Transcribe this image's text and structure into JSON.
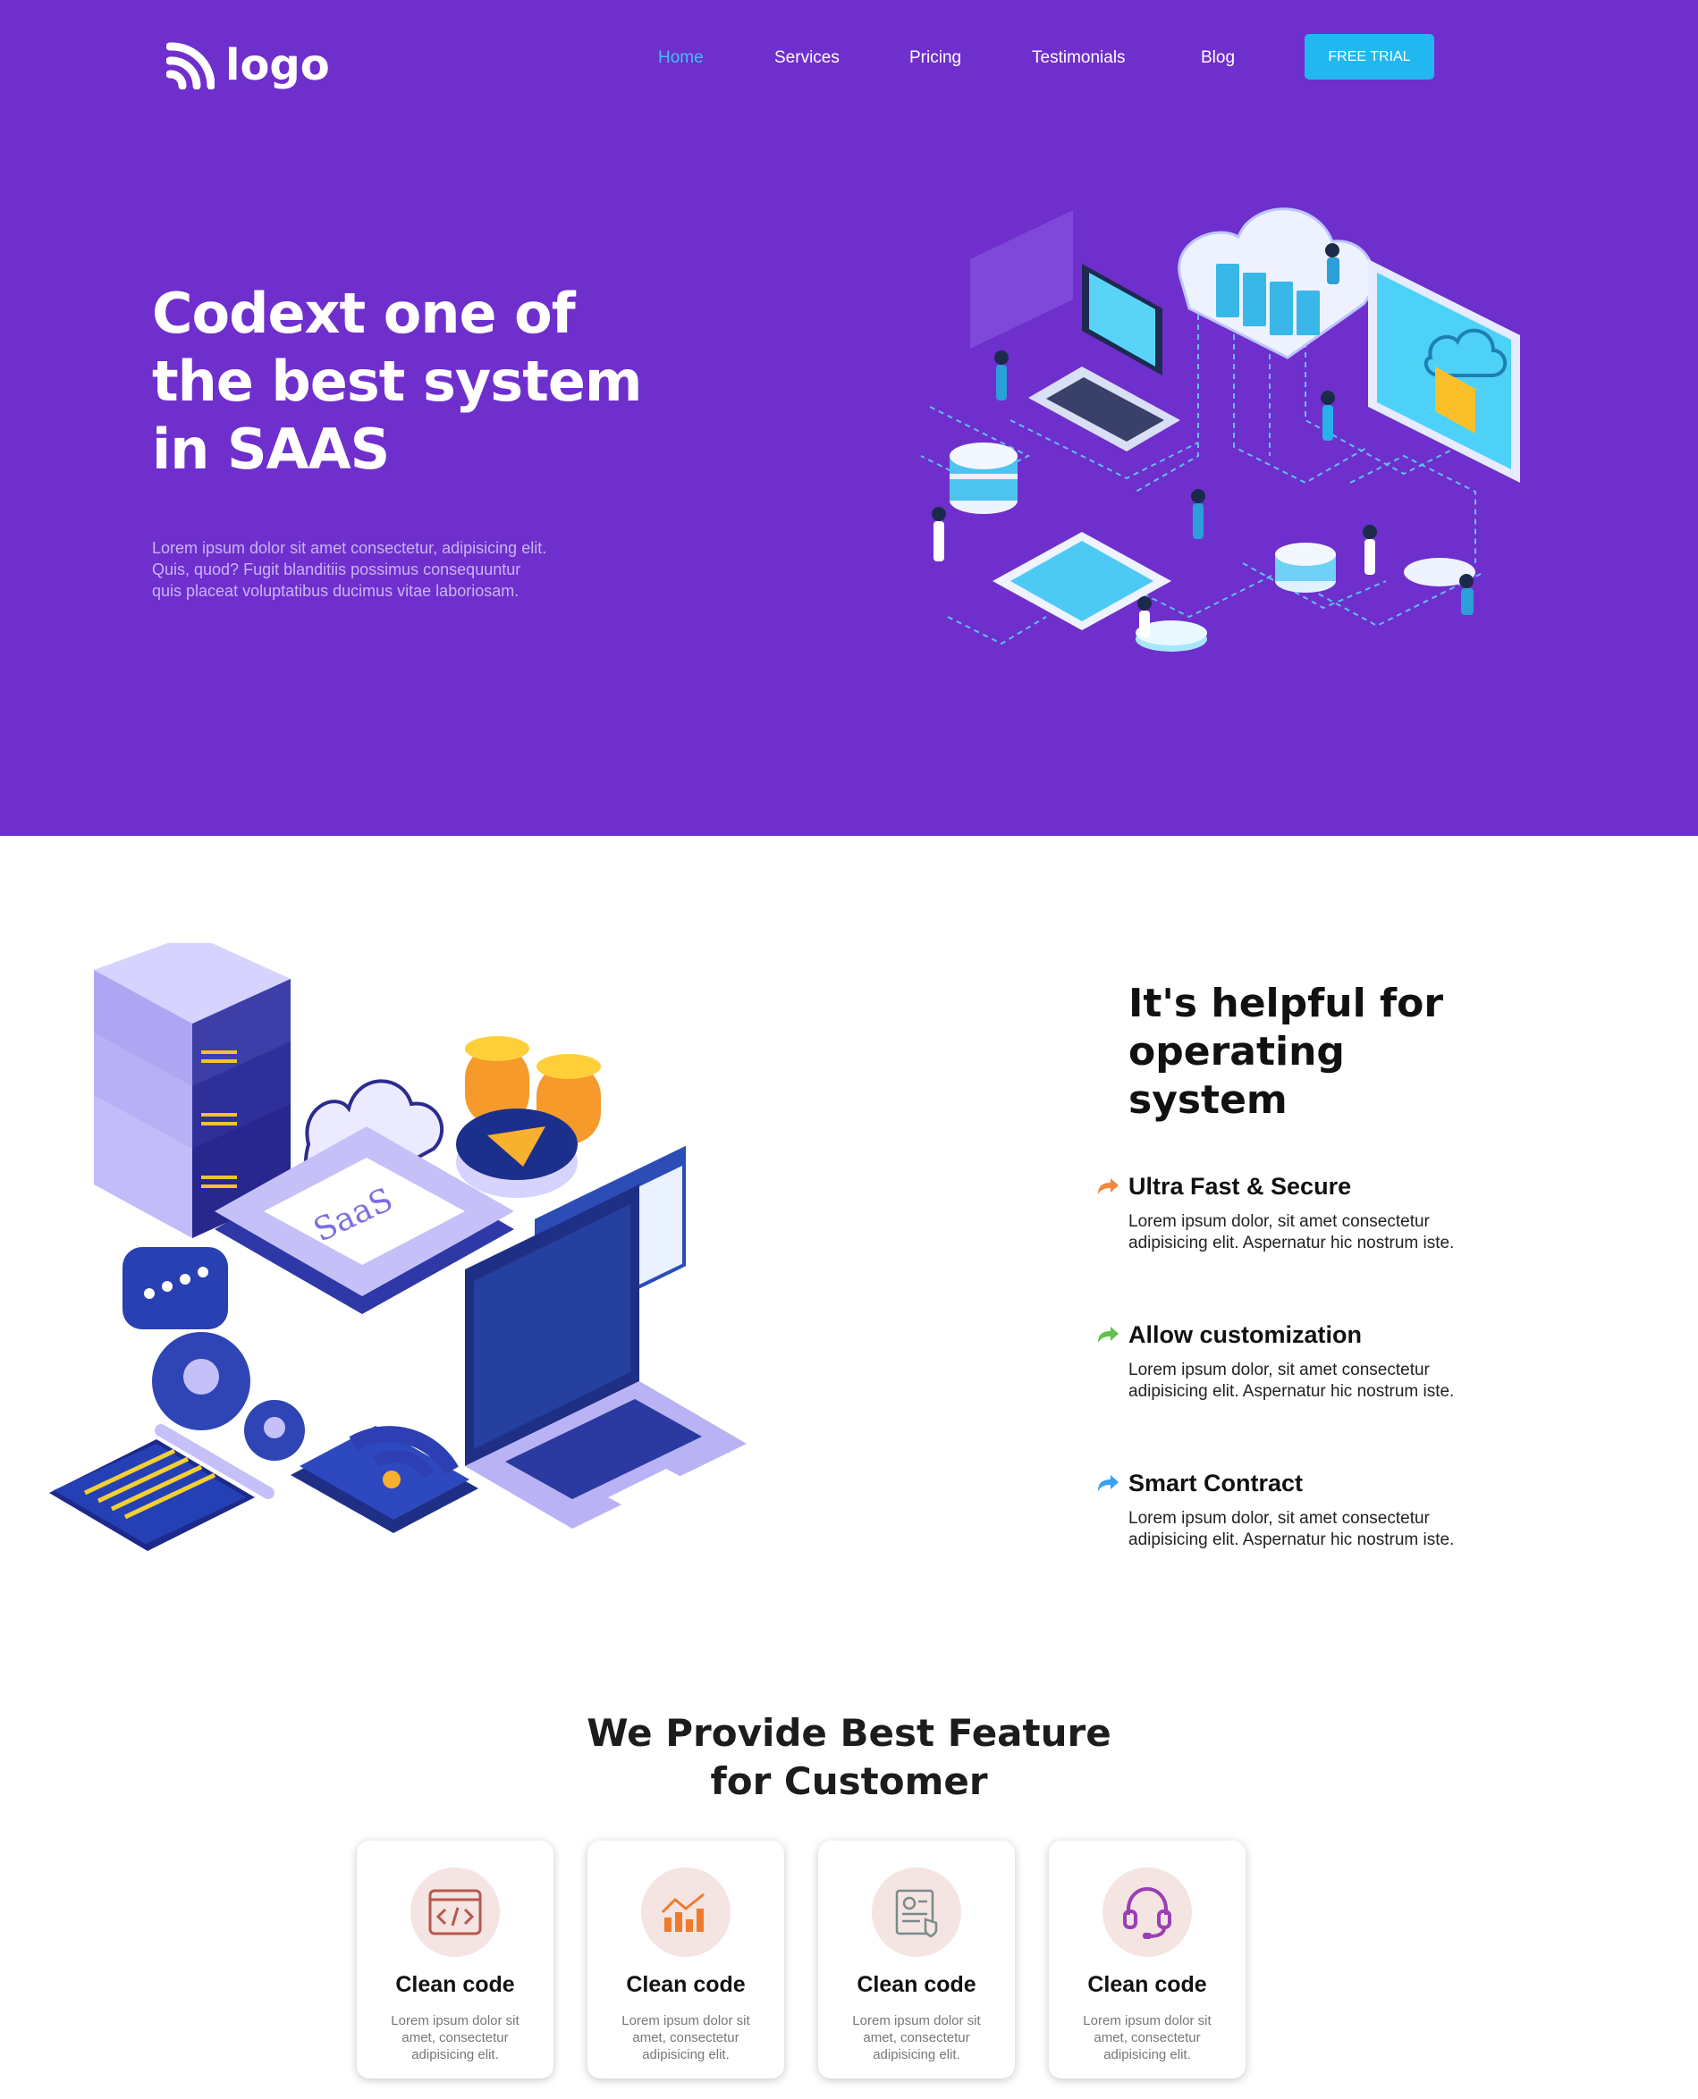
{
  "header": {
    "logo_text": "logo",
    "nav": [
      "Home",
      "Services",
      "Pricing",
      "Testimonials",
      "Blog"
    ],
    "cta_label": "FREE TRIAL"
  },
  "hero": {
    "title_lines": [
      "Codext one of",
      "the best system",
      "in SAAS"
    ],
    "text_lines": [
      "Lorem ipsum dolor sit amet consectetur, adipisicing elit.",
      "Quis, quod? Fugit blanditiis possimus consequuntur",
      "quis placeat voluptatibus ducimus vitae laboriosam."
    ]
  },
  "about": {
    "title_lines": [
      "It's helpful for operating",
      "system"
    ],
    "illustration_text": "SaaS",
    "features": [
      {
        "title": "Ultra Fast & Secure",
        "text": [
          "Lorem ipsum dolor, sit amet consectetur",
          "adipisicing elit. Aspernatur hic nostrum iste."
        ],
        "arrow_color": "#f0883e"
      },
      {
        "title": "Allow customization",
        "text": [
          "Lorem ipsum dolor, sit amet consectetur",
          "adipisicing elit. Aspernatur hic nostrum iste."
        ],
        "arrow_color": "#5cc54a"
      },
      {
        "title": "Smart Contract",
        "text": [
          "Lorem ipsum dolor, sit amet consectetur",
          "adipisicing elit. Aspernatur hic nostrum iste."
        ],
        "arrow_color": "#3aa0f0"
      }
    ]
  },
  "services": {
    "title_lines": [
      "We Provide Best Feature",
      "for Customer"
    ],
    "cards": [
      {
        "icon": "code-icon",
        "title": "Clean code",
        "text": [
          "Lorem ipsum dolor sit",
          "amet, consectetur",
          "adipisicing elit."
        ]
      },
      {
        "icon": "chart-icon",
        "title": "Clean code",
        "text": [
          "Lorem ipsum dolor sit",
          "amet, consectetur",
          "adipisicing elit."
        ]
      },
      {
        "icon": "certificate-icon",
        "title": "Clean code",
        "text": [
          "Lorem ipsum dolor sit",
          "amet, consectetur",
          "adipisicing elit."
        ]
      },
      {
        "icon": "headset-icon",
        "title": "Clean code",
        "text": [
          "Lorem ipsum dolor sit",
          "amet, consectetur",
          "adipisicing elit."
        ]
      }
    ]
  },
  "colors": {
    "hero_bg": "#6f2fcd",
    "cta": "#22b7f0",
    "nav_active": "#3fc2f2"
  }
}
